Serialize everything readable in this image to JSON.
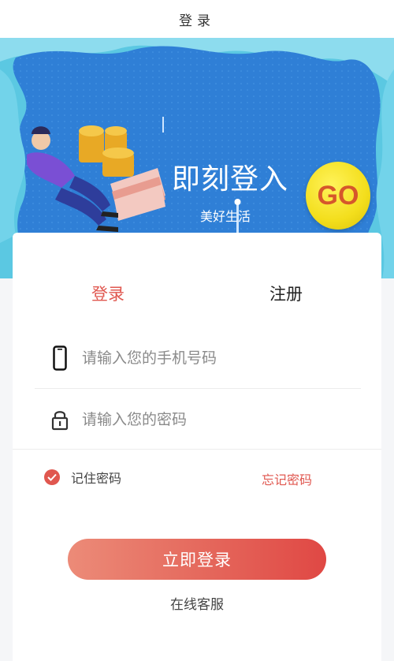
{
  "nav": {
    "title": "登录"
  },
  "banner": {
    "title": "即刻登入",
    "subtitle": "美好生活",
    "go_label": "GO"
  },
  "tabs": [
    {
      "label": "登录",
      "active": true
    },
    {
      "label": "注册",
      "active": false
    }
  ],
  "form": {
    "phone_placeholder": "请输入您的手机号码",
    "password_placeholder": "请输入您的密码",
    "remember_label": "记住密码",
    "remember_checked": true,
    "forgot_label": "忘记密码",
    "submit_label": "立即登录",
    "service_label": "在线客服"
  },
  "icons": {
    "phone": "phone-icon",
    "lock": "lock-icon",
    "check": "check-icon"
  },
  "colors": {
    "accent": "#e0574f",
    "banner_blue": "#2f7fd6",
    "banner_light": "#56c5e0",
    "go_yellow": "#f3de1c"
  }
}
